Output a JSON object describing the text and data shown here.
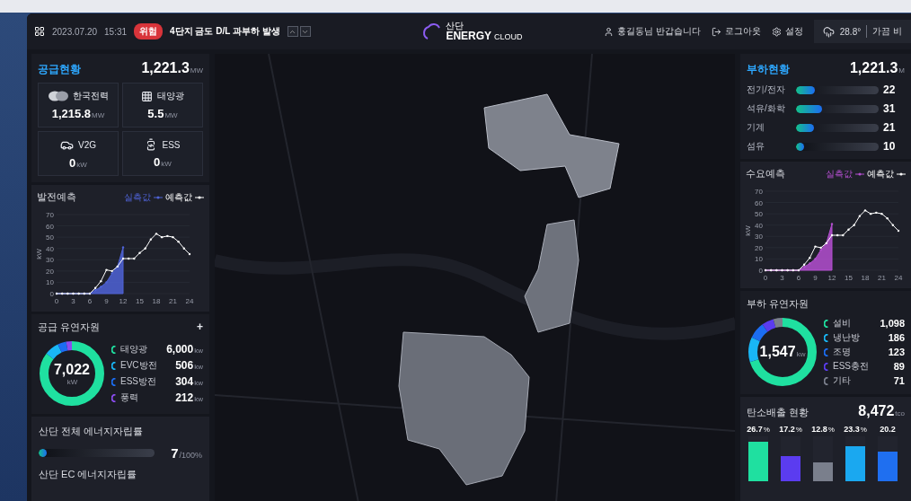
{
  "topbar": {
    "date": "2023.07.20",
    "time": "15:31",
    "alert": {
      "badge": "위험",
      "message": "4단지 금도 D/L 과부하 발생"
    },
    "logo": {
      "small": "산단",
      "main": "ENERGY",
      "sub": "CLOUD"
    },
    "user": "홍길동님 반갑습니다",
    "logout": "로그아웃",
    "settings": "설정",
    "weather": {
      "temp": "28.8°",
      "desc": "가끔 비"
    }
  },
  "supply": {
    "title": "공급현황",
    "total": "1,221.3",
    "unit": "MW",
    "sources": [
      {
        "kind": "utility",
        "label": "한국전력",
        "value": "1,215.8",
        "unit": "MW"
      },
      {
        "kind": "solar",
        "label": "태양광",
        "value": "5.5",
        "unit": "MW"
      },
      {
        "kind": "v2g",
        "label": "V2G",
        "value": "0",
        "unit": "kW"
      },
      {
        "kind": "ess",
        "label": "ESS",
        "value": "0",
        "unit": "kW"
      }
    ]
  },
  "generation_forecast": {
    "chart_data": {
      "type": "line",
      "grid": true,
      "title": "발전예측",
      "ylabel": "kW",
      "x": [
        0,
        1,
        2,
        3,
        4,
        5,
        6,
        7,
        8,
        9,
        10,
        11,
        12,
        13,
        14,
        15,
        16,
        17,
        18,
        19,
        20,
        21,
        22,
        23,
        24
      ],
      "xlim": [
        0,
        24
      ],
      "ylim": [
        0,
        70
      ],
      "xticks": [
        0,
        3,
        6,
        9,
        12,
        15,
        18,
        21,
        24
      ],
      "yticks": [
        0,
        10,
        20,
        30,
        40,
        50,
        60,
        70
      ],
      "series": [
        {
          "name": "실측값",
          "type": "area",
          "color": "#4f63d6",
          "values": [
            0,
            0,
            0,
            0,
            0,
            0,
            0,
            3,
            6,
            10,
            18,
            24,
            41,
            null,
            null,
            null,
            null,
            null,
            null,
            null,
            null,
            null,
            null,
            null,
            null
          ]
        },
        {
          "name": "예측값",
          "color": "#ffffff",
          "values": [
            0,
            0,
            0,
            0,
            0,
            0,
            0,
            5,
            11,
            21,
            20,
            24,
            31,
            31,
            31,
            36,
            40,
            48,
            53,
            50,
            51,
            50,
            46,
            40,
            35
          ]
        }
      ]
    }
  },
  "supply_resources": {
    "title": "공급 유연자원",
    "add": "+",
    "total": "7,022",
    "unit": "kW",
    "items": [
      {
        "label": "태양광",
        "value": "6,000",
        "unit": "kw",
        "color": "#1fe0a0"
      },
      {
        "label": "EVC방전",
        "value": "506",
        "unit": "kw",
        "color": "#19b6f5"
      },
      {
        "label": "ESS방전",
        "value": "304",
        "unit": "kw",
        "color": "#1c6df2"
      },
      {
        "label": "풍력",
        "value": "212",
        "unit": "kw",
        "color": "#8b4cf0"
      }
    ]
  },
  "self_sufficiency": [
    {
      "label": "산단 전체 에너지자립률",
      "level": 0.07,
      "value": "7",
      "max": "/100%"
    },
    {
      "label": "산단 EC 에너지자립률"
    }
  ],
  "load": {
    "title": "부하현황",
    "total": "1,221.3",
    "unit": "M",
    "sectors": [
      {
        "label": "전기/전자",
        "level": 0.23,
        "value": "22"
      },
      {
        "label": "석유/화학",
        "level": 0.32,
        "value": "31"
      },
      {
        "label": "기계",
        "level": 0.22,
        "value": "21"
      },
      {
        "label": "섬유",
        "level": 0.1,
        "value": "10"
      }
    ]
  },
  "demand_forecast": {
    "chart_data": {
      "type": "line",
      "grid": true,
      "title": "수요예측",
      "ylabel": "kW",
      "x": [
        0,
        1,
        2,
        3,
        4,
        5,
        6,
        7,
        8,
        9,
        10,
        11,
        12,
        13,
        14,
        15,
        16,
        17,
        18,
        19,
        20,
        21,
        22,
        23,
        24
      ],
      "xlim": [
        0,
        24
      ],
      "ylim": [
        0,
        70
      ],
      "xticks": [
        0,
        3,
        6,
        9,
        12,
        15,
        18,
        21,
        24
      ],
      "yticks": [
        0,
        10,
        20,
        30,
        40,
        50,
        60,
        70
      ],
      "series": [
        {
          "name": "실측값",
          "type": "area",
          "color": "#b44fd0",
          "values": [
            0,
            0,
            0,
            0,
            0,
            0,
            0,
            3,
            6,
            10,
            18,
            24,
            41,
            null,
            null,
            null,
            null,
            null,
            null,
            null,
            null,
            null,
            null,
            null,
            null
          ]
        },
        {
          "name": "예측값",
          "color": "#ffffff",
          "values": [
            0,
            0,
            0,
            0,
            0,
            0,
            0,
            5,
            11,
            21,
            20,
            24,
            31,
            31,
            31,
            36,
            40,
            48,
            53,
            50,
            51,
            50,
            46,
            40,
            35
          ]
        }
      ]
    }
  },
  "load_resources": {
    "title": "부하 유연자원",
    "total": "1,547",
    "unit": "kw",
    "items": [
      {
        "label": "설비",
        "value": "1,098",
        "color": "#1fe0a0"
      },
      {
        "label": "냉난방",
        "value": "186",
        "color": "#19b6f5"
      },
      {
        "label": "조명",
        "value": "123",
        "color": "#1c6df2"
      },
      {
        "label": "ESS충전",
        "value": "89",
        "color": "#5b3cf0"
      },
      {
        "label": "기타",
        "value": "71",
        "color": "#7a7f8c"
      }
    ]
  },
  "carbon": {
    "title": "탄소배출 현황",
    "total": "8,472",
    "unit": "tco",
    "bars": [
      {
        "value": "26.7",
        "unit": "%",
        "level": 0.89,
        "color": "#1fe0a0"
      },
      {
        "value": "17.2",
        "unit": "%",
        "level": 0.57,
        "color": "#5b3cf0"
      },
      {
        "value": "12.8",
        "unit": "%",
        "level": 0.43,
        "color": "#7a7f8c"
      },
      {
        "value": "23.3",
        "unit": "%",
        "level": 0.78,
        "color": "#1aa8f0"
      },
      {
        "value": "20.2",
        "level": 0.67,
        "color": "#1f6ff0"
      }
    ]
  }
}
